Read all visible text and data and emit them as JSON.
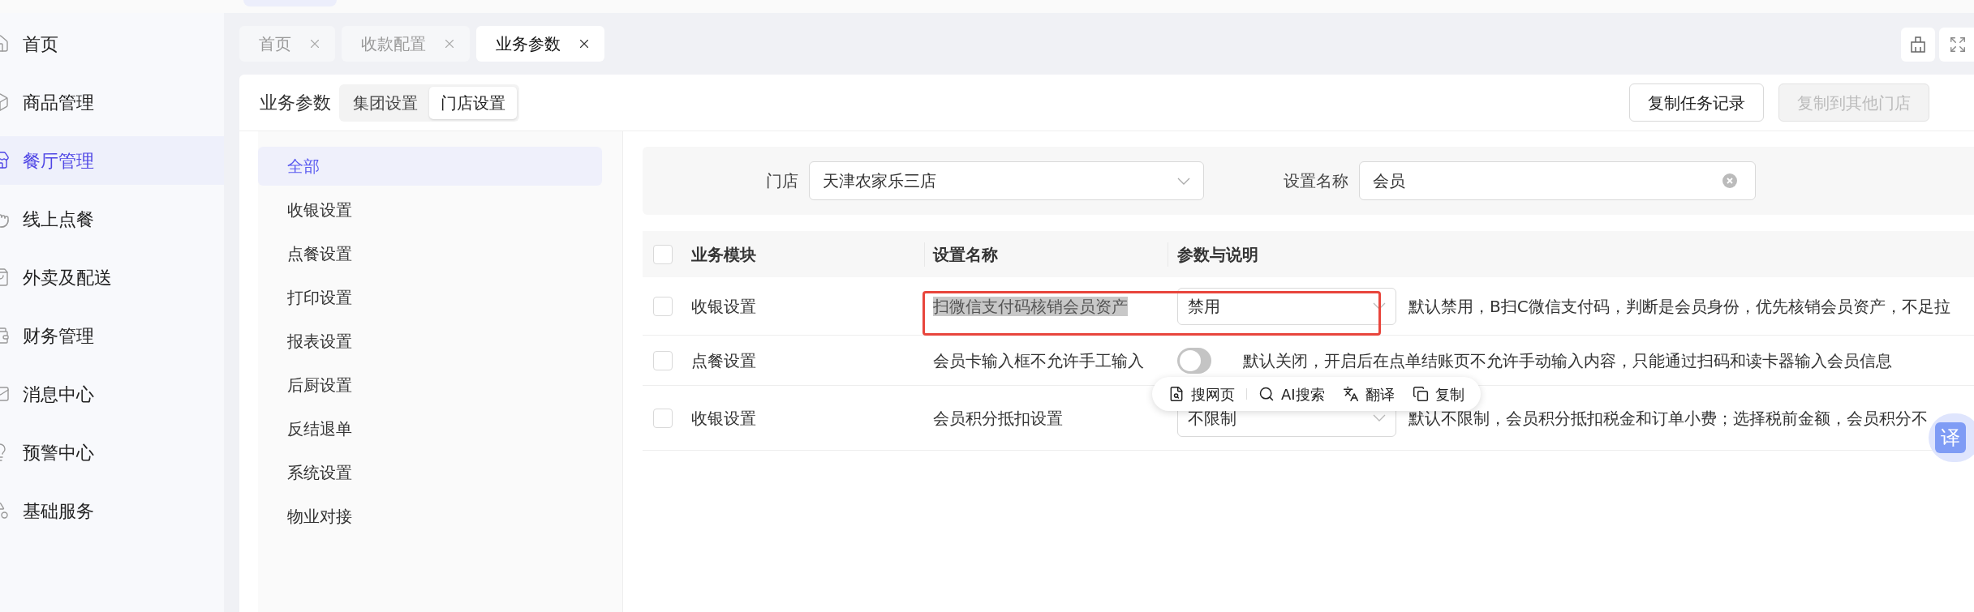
{
  "sidebar": {
    "items": [
      {
        "label": "首页",
        "selected": false
      },
      {
        "label": "商品管理",
        "selected": false
      },
      {
        "label": "餐厅管理",
        "selected": true
      },
      {
        "label": "线上点餐",
        "selected": false
      },
      {
        "label": "外卖及配送",
        "selected": false
      },
      {
        "label": "财务管理",
        "selected": false
      },
      {
        "label": "消息中心",
        "selected": false
      },
      {
        "label": "预警中心",
        "selected": false
      },
      {
        "label": "基础服务",
        "selected": false
      }
    ]
  },
  "tabs": [
    {
      "label": "首页",
      "selected": false
    },
    {
      "label": "收款配置",
      "selected": false
    },
    {
      "label": "业务参数",
      "selected": true
    }
  ],
  "page": {
    "title": "业务参数",
    "scope_tabs": [
      {
        "label": "集团设置",
        "selected": false
      },
      {
        "label": "门店设置",
        "selected": true
      }
    ],
    "buttons": [
      {
        "label": "复制任务记录",
        "disabled": false
      },
      {
        "label": "复制到其他门店",
        "disabled": true
      }
    ]
  },
  "categories": [
    {
      "label": "全部",
      "selected": true
    },
    {
      "label": "收银设置",
      "selected": false
    },
    {
      "label": "点餐设置",
      "selected": false
    },
    {
      "label": "打印设置",
      "selected": false
    },
    {
      "label": "报表设置",
      "selected": false
    },
    {
      "label": "后厨设置",
      "selected": false
    },
    {
      "label": "反结退单",
      "selected": false
    },
    {
      "label": "系统设置",
      "selected": false
    },
    {
      "label": "物业对接",
      "selected": false
    }
  ],
  "filters": {
    "store": {
      "label": "门店",
      "value": "天津农家乐三店"
    },
    "setting_name": {
      "label": "设置名称",
      "value": "会员"
    }
  },
  "table": {
    "header_checked": false,
    "columns": [
      "业务模块",
      "设置名称",
      "参数与说明"
    ],
    "rows": [
      {
        "checked": false,
        "module": "收银设置",
        "name": "扫微信支付码核销会员资产",
        "name_highlighted": true,
        "outlined": true,
        "control": {
          "kind": "select",
          "value": "禁用"
        },
        "description": "默认禁用，B扫C微信支付码，判断是会员身份，优先核销会员资产，不足拉"
      },
      {
        "checked": false,
        "module": "点餐设置",
        "name": "会员卡输入框不允许手工输入",
        "name_highlighted": false,
        "outlined": false,
        "control": {
          "kind": "switch",
          "on": false
        },
        "description": "默认关闭，开启后在点单结账页不允许手动输入内容，只能通过扫码和读卡器输入会员信息"
      },
      {
        "checked": false,
        "module": "收银设置",
        "name": "会员积分抵扣设置",
        "name_highlighted": false,
        "outlined": false,
        "control": {
          "kind": "select",
          "value": "不限制"
        },
        "description": "默认不限制，会员积分抵扣税金和订单小费；选择税前金额，会员积分不"
      }
    ]
  },
  "selection_popup": {
    "actions": [
      {
        "kind": "web-search",
        "label": "搜网页"
      },
      {
        "kind": "ai-search",
        "label": "AI搜索"
      },
      {
        "kind": "translate",
        "label": "翻译"
      },
      {
        "kind": "copy",
        "label": "复制"
      }
    ]
  },
  "translate_button": {
    "label": "译"
  }
}
